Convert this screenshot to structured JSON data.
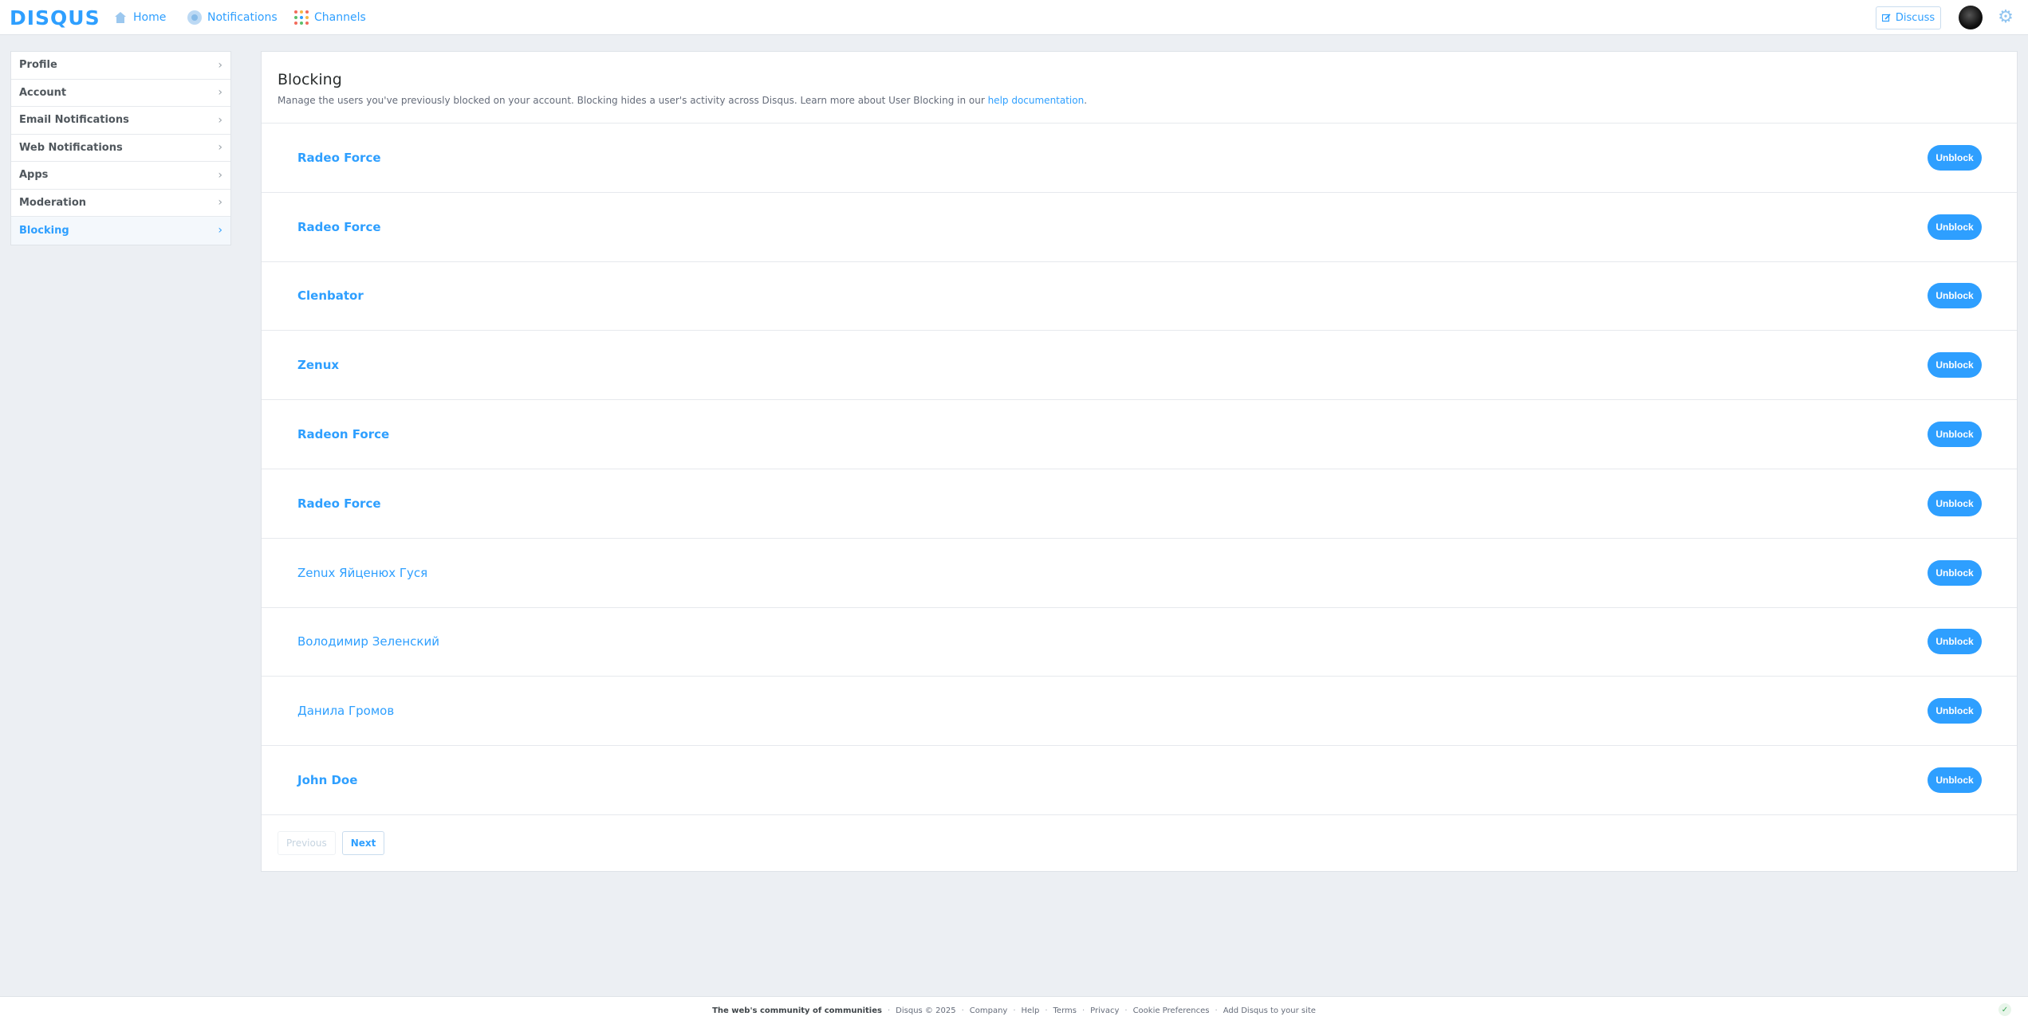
{
  "topbar": {
    "logo": "DISQUS",
    "nav": [
      {
        "label": "Home",
        "icon": "home-icon"
      },
      {
        "label": "Notifications",
        "icon": "notifications-icon"
      },
      {
        "label": "Channels",
        "icon": "channels-grid-icon"
      }
    ],
    "discuss_label": "Discuss",
    "accent_color": "#2e9fff"
  },
  "sidebar": {
    "items": [
      {
        "label": "Profile"
      },
      {
        "label": "Account"
      },
      {
        "label": "Email Notifications"
      },
      {
        "label": "Web Notifications"
      },
      {
        "label": "Apps"
      },
      {
        "label": "Moderation"
      },
      {
        "label": "Blocking",
        "active": true
      }
    ]
  },
  "main": {
    "title": "Blocking",
    "description": "Manage the users you've previously blocked on your account. Blocking hides a user's activity across Disqus. Learn more about User Blocking in our ",
    "help_link": "help documentation",
    "description_end": ".",
    "unblock_label": "Unblock",
    "blocked_users": [
      {
        "name": "Radeo Force"
      },
      {
        "name": "Radeo Force"
      },
      {
        "name": "Clenbator"
      },
      {
        "name": "Zenux"
      },
      {
        "name": "Radeon Force"
      },
      {
        "name": "Radeo Force"
      },
      {
        "name": "Zenux Яйценюх Гуся"
      },
      {
        "name": "Володимир Зеленский"
      },
      {
        "name": "Данила Громов"
      },
      {
        "name": "John Doe"
      }
    ],
    "pager": {
      "previous": "Previous",
      "next": "Next"
    }
  },
  "footer": {
    "tagline": "The web's community of communities",
    "copyright": "Disqus © 2025",
    "links": [
      "Company",
      "Help",
      "Terms",
      "Privacy",
      "Cookie Preferences",
      "Add Disqus to your site"
    ]
  }
}
